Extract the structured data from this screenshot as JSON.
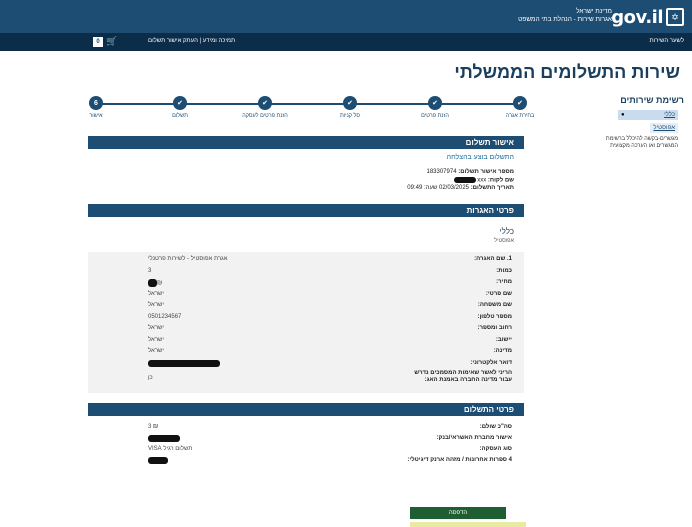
{
  "header": {
    "logo_text": "gov.il",
    "emblem": "✡",
    "gov_name": "מדינת ישראל",
    "ministry": "אגרות שירות - הנהלת בתי המשפט"
  },
  "subbar": {
    "back_label": "לשער השירות",
    "support_label": "תמיכה ומידע | העתק אישור תשלום",
    "cart_count": "0",
    "cart_icon": "🛒"
  },
  "page_title": "שירות התשלומים הממשלתי",
  "sidebar": {
    "title": "רשימת שירותים",
    "active_item": "כללי",
    "sub_item": "אפוסטיל",
    "note": "מגשרים-בקשה להיכלל ברשימת המגשרים ואו הערכה מקצועית"
  },
  "stepper": {
    "steps": [
      {
        "label": "בחירת אגרה",
        "mark": "✔"
      },
      {
        "label": "הזנת פרטים",
        "mark": "✔"
      },
      {
        "label": "סל קניות",
        "mark": "✔"
      },
      {
        "label": "הזנת פרטים לעסקה",
        "mark": "✔"
      },
      {
        "label": "תשלום",
        "mark": "✔"
      },
      {
        "label": "אישור",
        "mark": "6"
      }
    ]
  },
  "confirmation": {
    "bar_title": "אישור תשלום",
    "success": "התשלום בוצע בהצלחה",
    "confirm_label": "מספר אישור תשלום:",
    "confirm_value": "183307974",
    "customer_label": "שם לקוח:",
    "customer_value": "xxx",
    "date_label": "תאריך התשלום:",
    "date_value": "02/03/2025",
    "time_label": "שעה:",
    "time_value": "09:49"
  },
  "fees": {
    "bar_title": "פרטי האגרות",
    "section_title": "כללי",
    "section_sub": "אפוסטיל",
    "rows": [
      {
        "k": "1. שם האגרה:",
        "v": "אגרת אפוסטיל - לשירות פרטנלי"
      },
      {
        "k": "כמות:",
        "v": "3"
      },
      {
        "k": "מחיר:",
        "v": "₪"
      },
      {
        "k": "שם פרטי:",
        "v": "ישראל"
      },
      {
        "k": "שם משפחה:",
        "v": "ישראל"
      },
      {
        "k": "מספר טלפון:",
        "v": "0501234567"
      },
      {
        "k": "רחוב ומספר:",
        "v": "ישראל"
      },
      {
        "k": "יישוב:",
        "v": "ישראל"
      },
      {
        "k": "מדינה:",
        "v": "ישראל"
      },
      {
        "k": "דואר אלקטרוני:",
        "v": ""
      }
    ],
    "declaration_k1": "הריני לאשר שאימות המסמכים נדרש",
    "declaration_k2": "עבור מדינה החברה באמנת האג:",
    "declaration_v": "כן"
  },
  "payment": {
    "bar_title": "פרטי התשלום",
    "rows": [
      {
        "k": "סה\"כ שולם:",
        "v": "₪ 3"
      },
      {
        "k": "אישור מחברת האשראי/בנק:",
        "v": ""
      },
      {
        "k": "סוג העסקה:",
        "v": "תשלום רגיל VISA"
      },
      {
        "k": "4 ספרות אחרונות / מזהה ארנק דיגיטלי:",
        "v": ""
      }
    ]
  },
  "print_label": "הדפסה",
  "colors": {
    "primary": "#1d4d73",
    "dark": "#0c2d4a",
    "print": "#1f5e30"
  }
}
